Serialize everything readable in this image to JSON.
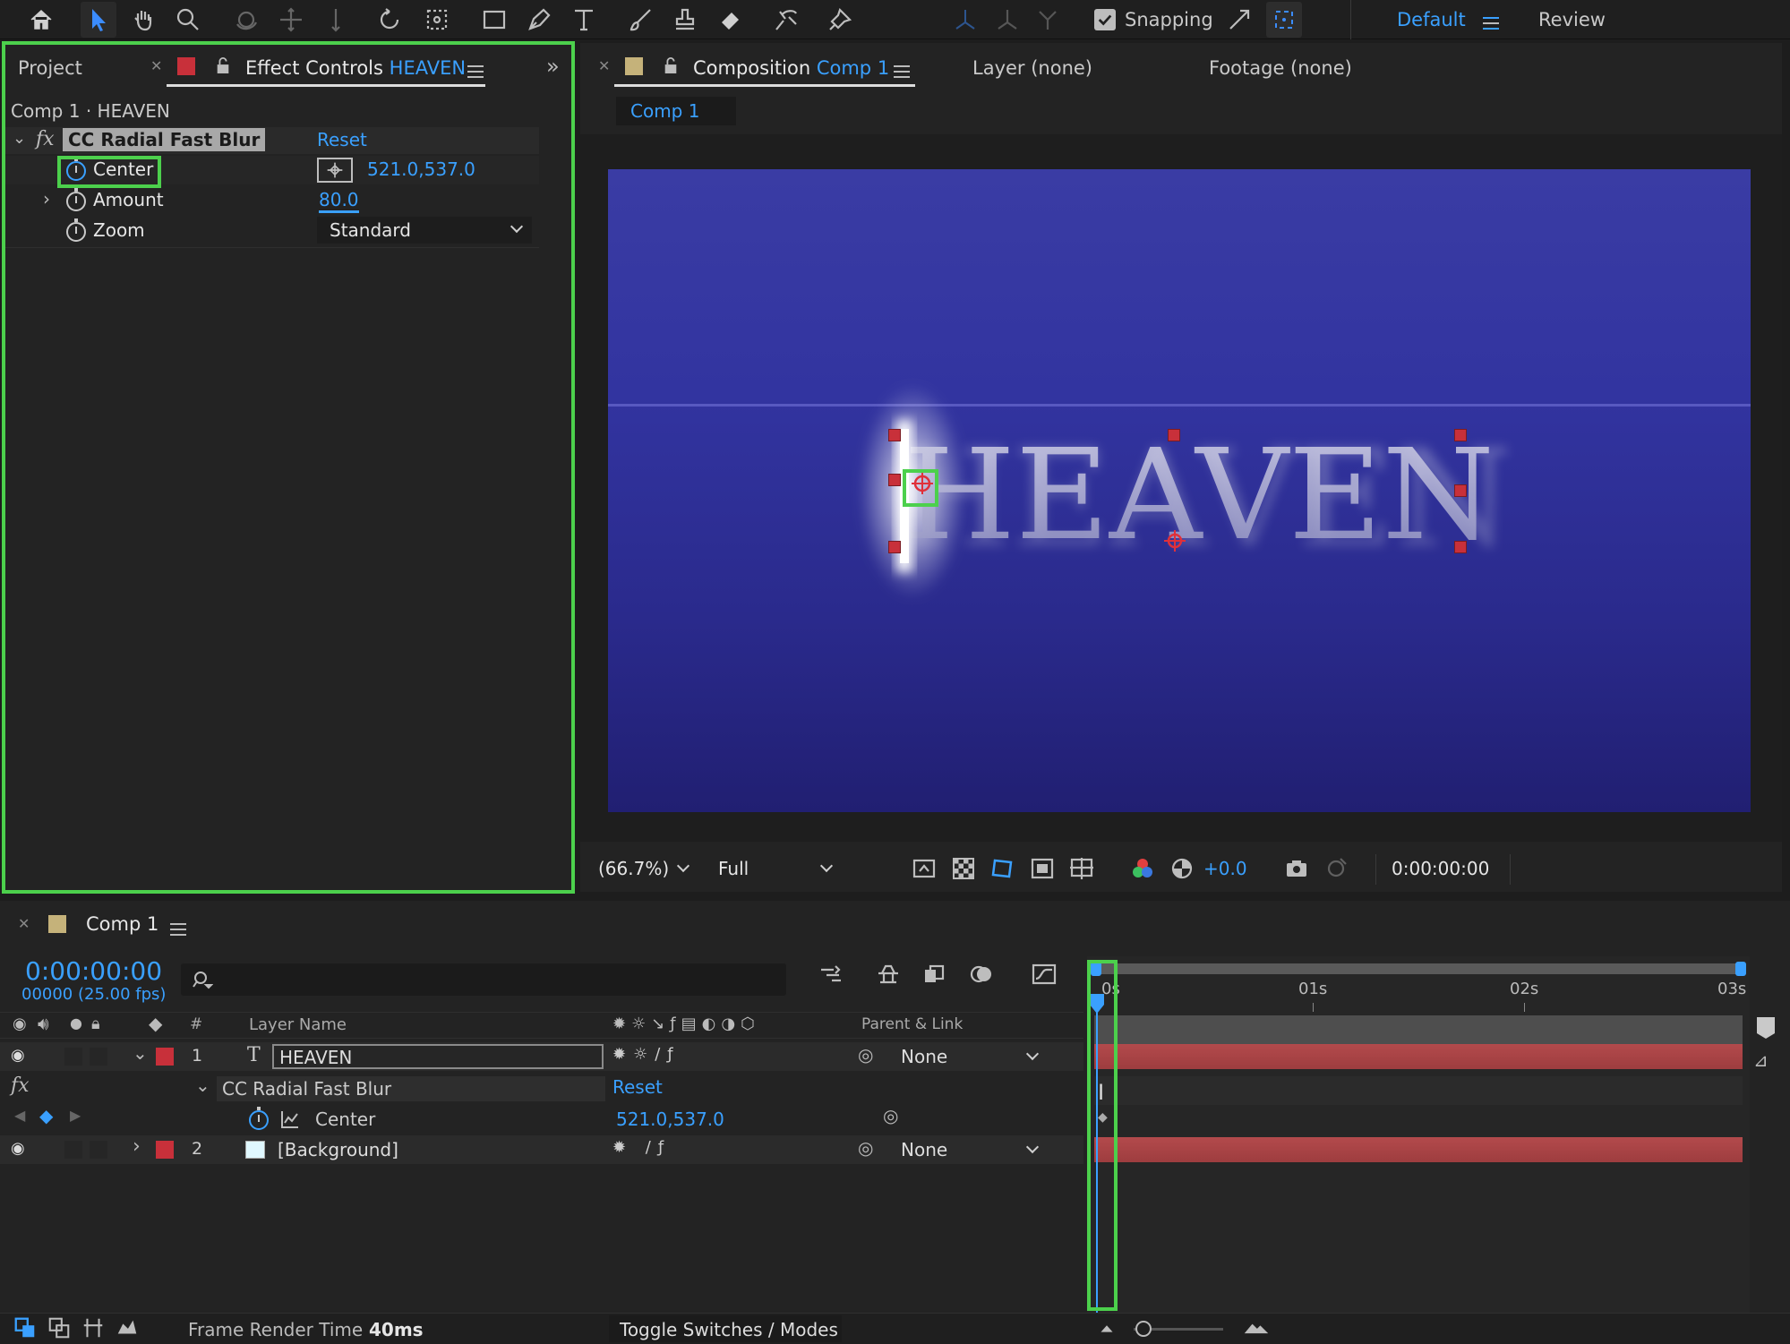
{
  "toolbar": {
    "snapping_label": "Snapping",
    "workspace_active": "Default",
    "workspace_review": "Review"
  },
  "left_panel": {
    "tab_project": "Project",
    "tab_effect_prefix": "Effect Controls",
    "tab_effect_layer": "HEAVEN",
    "breadcrumb": "Comp 1 · HEAVEN",
    "effect_name": "CC Radial Fast Blur",
    "reset_label": "Reset",
    "props": [
      {
        "name": "Center",
        "value": "521.0,537.0"
      },
      {
        "name": "Amount",
        "value": "80.0"
      },
      {
        "name": "Zoom",
        "value": "Standard"
      }
    ]
  },
  "viewer": {
    "tab_prefix": "Composition",
    "tab_comp": "Comp 1",
    "tab_layer": "Layer (none)",
    "tab_footage": "Footage (none)",
    "sub_tab": "Comp 1",
    "canvas_text": "HEAVEN",
    "zoom": "(66.7%)",
    "resolution": "Full",
    "exposure": "+0.0",
    "timecode": "0:00:00:00",
    "colors": {
      "bg_top": "#3a3c9e",
      "bg_bottom": "#23227a"
    }
  },
  "timeline": {
    "tab_label": "Comp 1",
    "timecode": "0:00:00:00",
    "fps": "00000 (25.00 fps)",
    "search_placeholder": "",
    "col_hash": "#",
    "col_layer_name": "Layer Name",
    "col_parent": "Parent & Link",
    "ruler": [
      "0s",
      "01s",
      "02s",
      "03s"
    ],
    "layers": [
      {
        "num": "1",
        "name": "HEAVEN",
        "parent": "None",
        "type": "T"
      },
      {
        "num": "2",
        "name": "[Background]",
        "parent": "None",
        "type": "solid"
      }
    ],
    "effect_row": {
      "name": "CC Radial Fast Blur",
      "reset": "Reset"
    },
    "center_row": {
      "name": "Center",
      "value": "521.0,537.0"
    },
    "footer": {
      "render_label": "Frame Render Time",
      "render_value": "40ms",
      "toggle_label": "Toggle Switches / Modes"
    }
  }
}
